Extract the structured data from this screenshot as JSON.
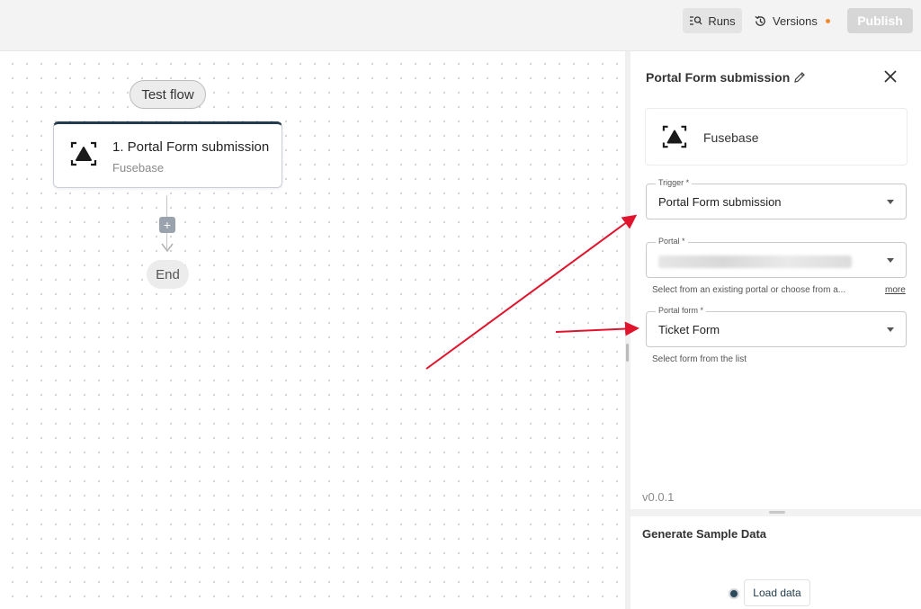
{
  "topbar": {
    "runs_label": "Runs",
    "versions_label": "Versions",
    "publish_label": "Publish"
  },
  "canvas": {
    "test_flow_label": "Test flow",
    "step": {
      "title": "1. Portal Form submission",
      "subtitle": "Fusebase"
    },
    "add_symbol": "+",
    "end_label": "End"
  },
  "panel": {
    "title": "Portal Form submission",
    "piece_name": "Fusebase",
    "fields": [
      {
        "label": "Trigger *",
        "value": "Portal Form submission"
      },
      {
        "label": "Portal *",
        "value": ""
      },
      {
        "label": "Portal form *",
        "value": "Ticket Form"
      }
    ],
    "portal_helper": "Select from an existing portal or choose from a...",
    "more_label": "more",
    "form_helper": "Select form from the list",
    "version": "v0.0.1"
  },
  "sample": {
    "title": "Generate Sample Data",
    "load_label": "Load data"
  },
  "colors": {
    "accent_dark": "#233b4f",
    "annotation_red": "#e0142c",
    "versions_dot": "#f08c2a"
  }
}
